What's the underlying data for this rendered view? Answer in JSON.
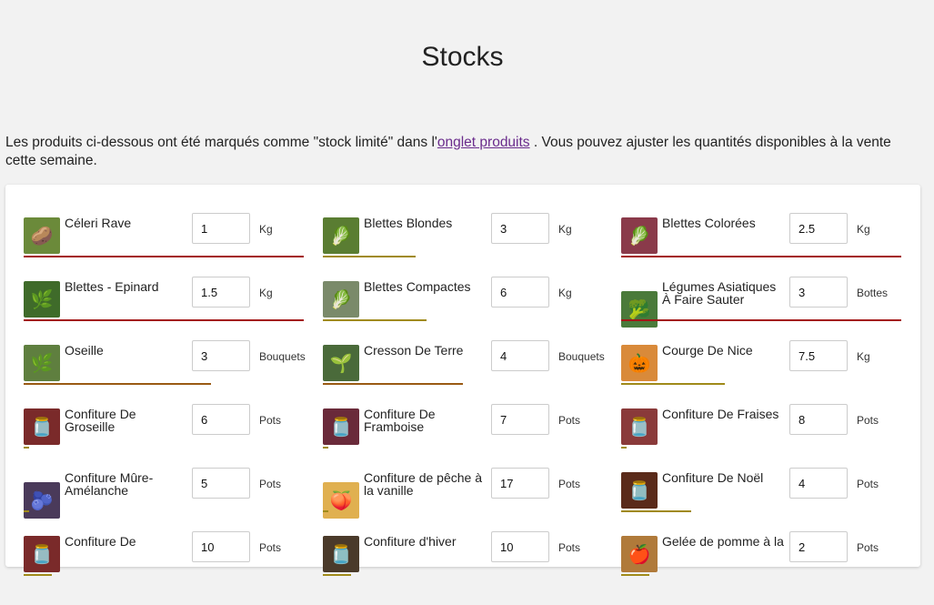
{
  "page": {
    "title": "Stocks",
    "intro_before": "Les produits ci-dessous ont été marqués comme \"stock limité\" dans l'",
    "intro_link": "onglet produits",
    "intro_after": " . Vous pouvez ajuster les quantités disponibles à la vente cette semaine."
  },
  "colors": {
    "link": "#6a2c8c",
    "bar_red": "#a31616",
    "bar_olive": "#a08a1a",
    "bar_brown": "#9a5a14"
  },
  "products": [
    {
      "name": "Céleri Rave",
      "qty": "1",
      "unit": "Kg",
      "stock_fill": 1.0,
      "bar_color": "#a31616",
      "icon": "celeriac-icon",
      "glyph": "🥔"
    },
    {
      "name": "Blettes Blondes",
      "qty": "3",
      "unit": "Kg",
      "stock_fill": 0.33,
      "bar_color": "#a08a1a",
      "icon": "chard-icon",
      "glyph": "🥬"
    },
    {
      "name": "Blettes Colorées",
      "qty": "2.5",
      "unit": "Kg",
      "stock_fill": 1.0,
      "bar_color": "#a31616",
      "icon": "chard-icon",
      "glyph": "🥬"
    },
    {
      "name": "Blettes - Epinard",
      "qty": "1.5",
      "unit": "Kg",
      "stock_fill": 1.0,
      "bar_color": "#a31616",
      "icon": "spinach-icon",
      "glyph": "🌿"
    },
    {
      "name": "Blettes Compactes",
      "qty": "6",
      "unit": "Kg",
      "stock_fill": 0.37,
      "bar_color": "#a08a1a",
      "icon": "chard-icon",
      "glyph": "🥬"
    },
    {
      "name": "Légumes Asiatiques À Faire Sauter",
      "qty": "3",
      "unit": "Bottes",
      "stock_fill": 1.0,
      "bar_color": "#a31616",
      "icon": "greens-icon",
      "glyph": "🥦"
    },
    {
      "name": "Oseille",
      "qty": "3",
      "unit": "Bouquets",
      "stock_fill": 0.67,
      "bar_color": "#9a5a14",
      "icon": "sorrel-icon",
      "glyph": "🌿"
    },
    {
      "name": "Cresson De Terre",
      "qty": "4",
      "unit": "Bouquets",
      "stock_fill": 0.5,
      "bar_color": "#9a5a14",
      "icon": "cress-icon",
      "glyph": "🌱"
    },
    {
      "name": "Courge De Nice",
      "qty": "7.5",
      "unit": "Kg",
      "stock_fill": 0.37,
      "bar_color": "#a08a1a",
      "icon": "squash-icon",
      "glyph": "🎃"
    },
    {
      "name": "Confiture De Groseille",
      "qty": "6",
      "unit": "Pots",
      "stock_fill": 0.02,
      "bar_color": "#a08a1a",
      "icon": "jam-jar-icon",
      "glyph": "🫙"
    },
    {
      "name": "Confiture De Framboise",
      "qty": "7",
      "unit": "Pots",
      "stock_fill": 0.02,
      "bar_color": "#a08a1a",
      "icon": "jam-jar-icon",
      "glyph": "🫙"
    },
    {
      "name": "Confiture De Fraises",
      "qty": "8",
      "unit": "Pots",
      "stock_fill": 0.02,
      "bar_color": "#a08a1a",
      "icon": "jam-jar-icon",
      "glyph": "🫙"
    },
    {
      "name": "Confiture Mûre-Amélanche",
      "qty": "5",
      "unit": "Pots",
      "stock_fill": 0.02,
      "bar_color": "#a08a1a",
      "icon": "jam-jar-icon",
      "glyph": "🫐"
    },
    {
      "name": "Confiture de pêche à la vanille",
      "qty": "17",
      "unit": "Pots",
      "stock_fill": 0.02,
      "bar_color": "#a08a1a",
      "icon": "jam-jar-icon",
      "glyph": "🍑"
    },
    {
      "name": "Confiture De Noël",
      "qty": "4",
      "unit": "Pots",
      "stock_fill": 0.25,
      "bar_color": "#a08a1a",
      "icon": "jam-jar-icon",
      "glyph": "🫙"
    },
    {
      "name": "Confiture De",
      "qty": "10",
      "unit": "Pots",
      "stock_fill": 0.1,
      "bar_color": "#a08a1a",
      "icon": "jam-jar-icon",
      "glyph": "🫙"
    },
    {
      "name": "Confiture d'hiver",
      "qty": "10",
      "unit": "Pots",
      "stock_fill": 0.1,
      "bar_color": "#a08a1a",
      "icon": "jam-jar-icon",
      "glyph": "🫙"
    },
    {
      "name": "Gelée de pomme à la",
      "qty": "2",
      "unit": "Pots",
      "stock_fill": 0.1,
      "bar_color": "#a08a1a",
      "icon": "jelly-jar-icon",
      "glyph": "🍎"
    }
  ]
}
